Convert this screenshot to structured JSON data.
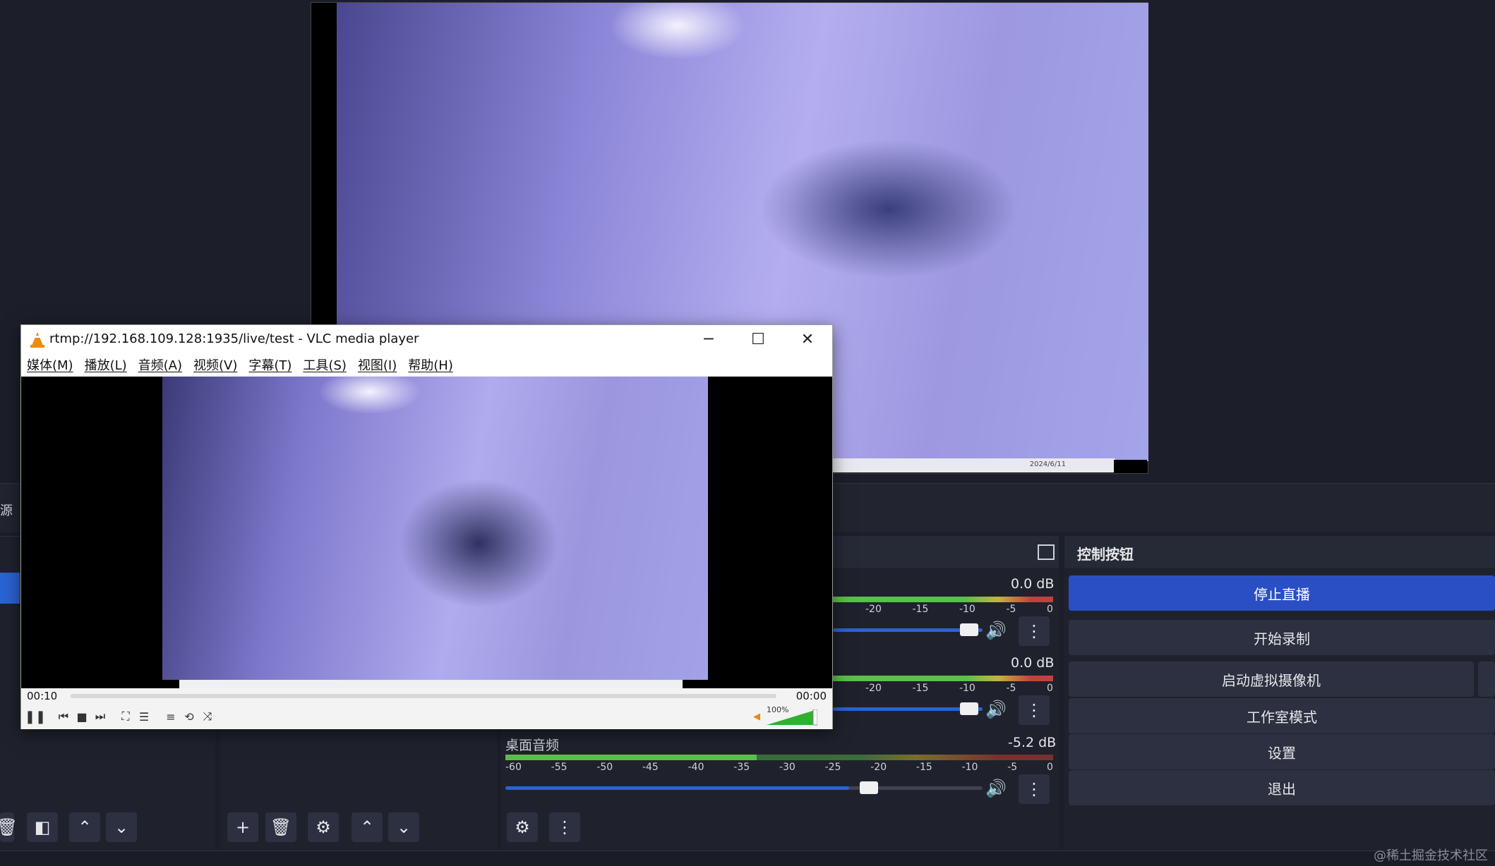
{
  "obs": {
    "controls_title": "控制按钮",
    "buttons": {
      "stop_stream": "停止直播",
      "start_record": "开始录制",
      "virtual_cam": "启动虚拟摄像机",
      "studio_mode": "工作室模式",
      "settings": "设置",
      "exit": "退出"
    },
    "mixer": {
      "tracks": [
        {
          "db": "0.0 dB"
        },
        {
          "db": "0.0 dB"
        },
        {
          "name": "桌面音频",
          "db": "-5.2 dB"
        }
      ],
      "ticks_partial": [
        "-20",
        "-15",
        "-10",
        "-5",
        "0"
      ],
      "ticks_full": [
        "-60",
        "-55",
        "-50",
        "-45",
        "-40",
        "-35",
        "-30",
        "-25",
        "-20",
        "-15",
        "-10",
        "-5",
        "0"
      ]
    },
    "statusbar": {
      "watermark": "@稀土掘金技术社区"
    },
    "left_panel_fragment": "源",
    "preview_date": "2024/6/11"
  },
  "vlc": {
    "title": "rtmp://192.168.109.128:1935/live/test - VLC media player",
    "menu": [
      "媒体(M)",
      "播放(L)",
      "音频(A)",
      "视频(V)",
      "字幕(T)",
      "工具(S)",
      "视图(I)",
      "帮助(H)"
    ],
    "elapsed": "00:10",
    "remaining": "00:00",
    "volume_label": "100%",
    "volume_level": 1.0
  },
  "colors": {
    "accent": "#2a4fc4",
    "panel": "#2c3040",
    "background": "#1c1f2a"
  }
}
